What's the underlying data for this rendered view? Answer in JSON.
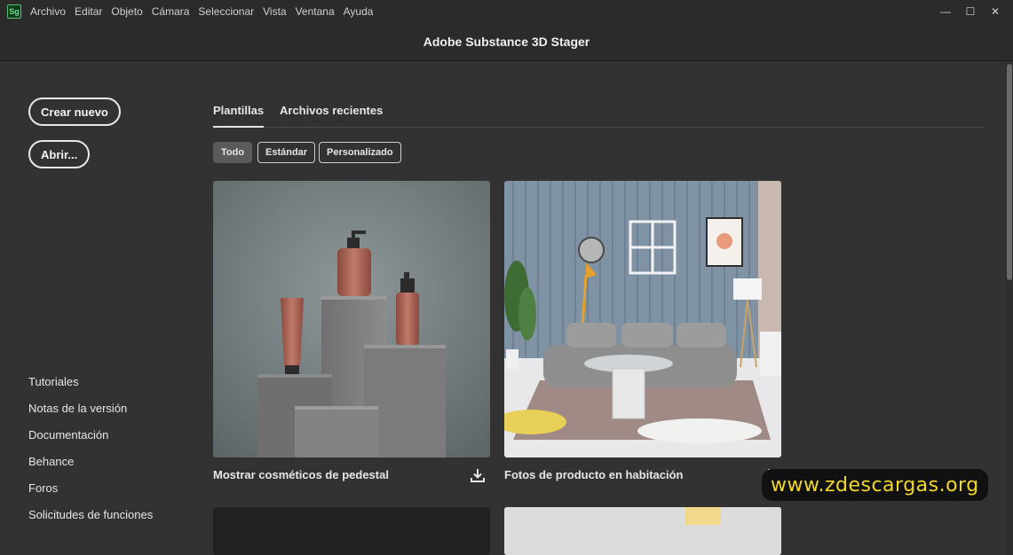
{
  "app": {
    "logo_text": "Sg",
    "title": "Adobe Substance 3D Stager",
    "menu": [
      "Archivo",
      "Editar",
      "Objeto",
      "Cámara",
      "Seleccionar",
      "Vista",
      "Ventana",
      "Ayuda"
    ],
    "window_controls": {
      "minimize": "—",
      "maximize": "☐",
      "close": "✕"
    }
  },
  "left_panel": {
    "create_new": "Crear nuevo",
    "open": "Abrir...",
    "links": [
      "Tutoriales",
      "Notas de la versión",
      "Documentación",
      "Behance",
      "Foros",
      "Solicitudes de funciones"
    ]
  },
  "tabs": [
    {
      "label": "Plantillas",
      "active": true
    },
    {
      "label": "Archivos recientes",
      "active": false
    }
  ],
  "filters": [
    {
      "label": "Todo",
      "selected": true
    },
    {
      "label": "Estándar",
      "selected": false
    },
    {
      "label": "Personalizado",
      "selected": false
    }
  ],
  "templates": [
    {
      "label": "Mostrar cosméticos de pedestal",
      "icon": "download-icon"
    },
    {
      "label": "Fotos de producto en habitación",
      "icon": "download-icon"
    }
  ],
  "watermark": "www.zdescargas.org",
  "colors": {
    "background": "#323232",
    "bar": "#2b2b2b",
    "accent": "#4a8fd6",
    "watermark_text": "#f2d72b"
  }
}
